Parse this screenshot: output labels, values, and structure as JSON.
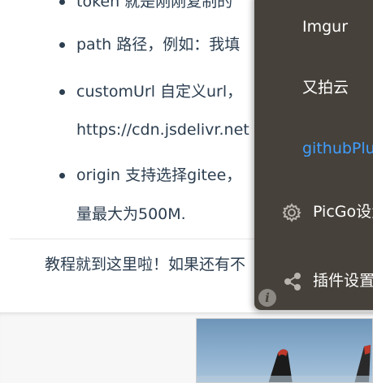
{
  "article": {
    "bullets": [
      {
        "text": "token 就是刚刚复制的"
      },
      {
        "text": "path 路径，例如：我填"
      },
      {
        "text": "customUrl 自定义url，",
        "continuation": "https://cdn.jsdelivr.net"
      },
      {
        "text": "origin 支持选择gitee，",
        "continuation": "量最大为500M."
      }
    ],
    "closing": "教程就到这里啦！如果还有不"
  },
  "menu": {
    "items": [
      {
        "label": "Imgur",
        "icon": "",
        "active": false
      },
      {
        "label": "又拍云",
        "icon": "",
        "active": false
      },
      {
        "label": "githubPlus",
        "icon": "",
        "active": true
      },
      {
        "label": "PicGo设置",
        "icon": "gear-icon",
        "active": false
      },
      {
        "label": "插件设置",
        "icon": "share-icon",
        "active": false
      }
    ],
    "info_icon": "info-icon",
    "active_color": "#409eff",
    "background_color": "#46413a"
  }
}
